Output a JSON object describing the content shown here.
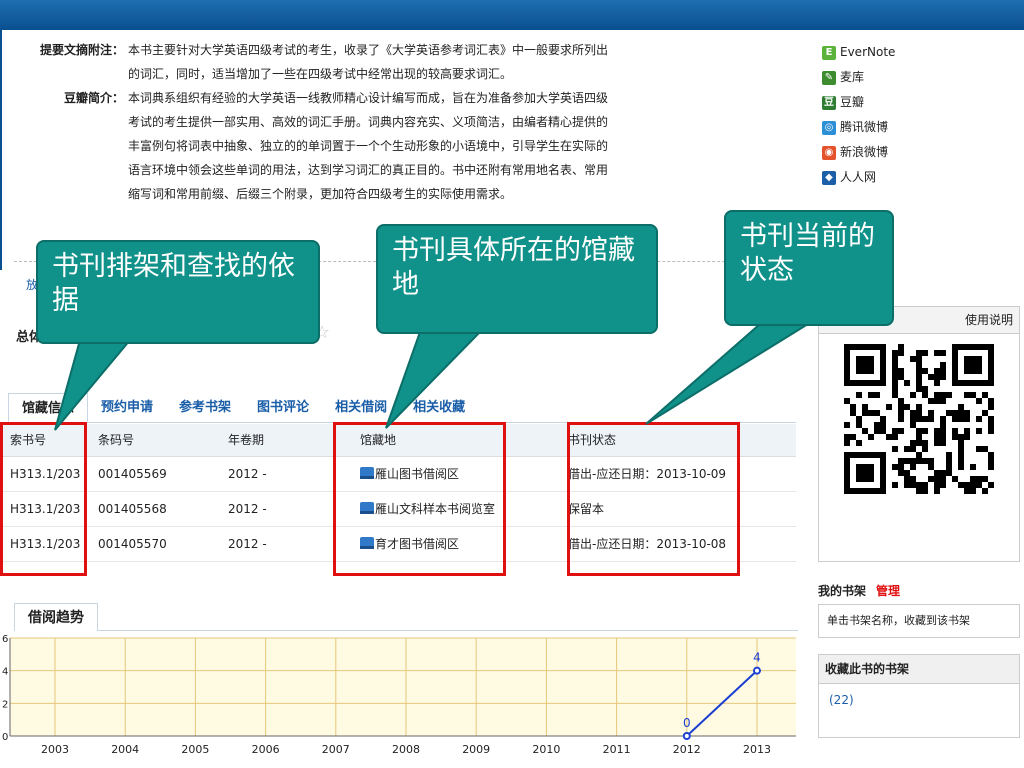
{
  "summary": {
    "abstract_label": "提要文摘附注：",
    "abstract_lines": [
      "本书主要针对大学英语四级考试的考生，收录了《大学英语参考词汇表》中一般要求所列出",
      "的词汇，同时，适当增加了一些在四级考试中经常出现的较高要求词汇。"
    ],
    "douban_label": "豆瓣简介：",
    "douban_lines": [
      "本词典系组织有经验的大学英语一线教师精心设计编写而成，旨在为准备参加大学英语四级",
      "考试的考生提供一部实用、高效的词汇手册。词典内容充实、义项简洁，由编者精心提供的",
      "丰富例句将词表中抽象、独立的的单词置于一个个生动形象的小语境中，引导学生在实际的",
      "语言环境中领会这些单词的用法，达到学习词汇的真正目的。书中还附有常用地名表、常用",
      "缩写词和常用前缀、后缀三个附录，更加符合四级考生的实际使用需求。"
    ]
  },
  "hidden_left": {
    "link": "放",
    "label": "总体"
  },
  "tabs": [
    "馆藏信息",
    "预约申请",
    "参考书架",
    "图书评论",
    "相关借阅",
    "相关收藏"
  ],
  "holdings": {
    "headers": [
      "索书号",
      "条码号",
      "年卷期",
      "馆藏地",
      "书刊状态"
    ],
    "rows": [
      [
        "H313.1/203",
        "001405569",
        "2012 -",
        "雁山图书借阅区",
        "借出-应还日期：2013-10-09"
      ],
      [
        "H313.1/203",
        "001405568",
        "2012 -",
        "雁山文科样本书阅览室",
        "保留本"
      ],
      [
        "H313.1/203",
        "001405570",
        "2012 -",
        "育才图书借阅区",
        "借出-应还日期：2013-10-08"
      ]
    ]
  },
  "trend": {
    "tab_label": "借阅趋势",
    "chart_data": {
      "type": "line",
      "x": [
        "2003",
        "2004",
        "2005",
        "2006",
        "2007",
        "2008",
        "2009",
        "2010",
        "2011",
        "2012",
        "2013"
      ],
      "y_ticks": [
        "6",
        "4",
        "2",
        "0"
      ],
      "ylim": [
        0,
        6
      ],
      "series": [
        {
          "points": [
            {
              "x": "2012",
              "y": 0
            },
            {
              "x": "2013",
              "y": 4
            }
          ],
          "labels": [
            "0",
            "4"
          ]
        }
      ],
      "grid": true,
      "colors": {
        "line": "#1a3fd1",
        "grid": "#e6c77a",
        "background": "#fffbe3"
      }
    }
  },
  "share": [
    {
      "label": "EverNote",
      "icon": "evernote-icon",
      "color": "#5bb33b",
      "glyph": "E"
    },
    {
      "label": "麦库",
      "icon": "maiku-icon",
      "color": "#3d8c2f",
      "glyph": "✎"
    },
    {
      "label": "豆瓣",
      "icon": "douban-icon",
      "color": "#2f7d32",
      "glyph": "豆"
    },
    {
      "label": "腾讯微博",
      "icon": "tencent-weibo-icon",
      "color": "#2d8fd5",
      "glyph": "◎"
    },
    {
      "label": "新浪微博",
      "icon": "sina-weibo-icon",
      "color": "#e5532d",
      "glyph": "◉"
    },
    {
      "label": "人人网",
      "icon": "renren-icon",
      "color": "#1d5ea8",
      "glyph": "◆"
    }
  ],
  "usage_label": "使用说明",
  "shelf": {
    "title": "我的书架",
    "manage": "管理",
    "note": "单击书架名称，收藏到该书架"
  },
  "collect": {
    "title": "收藏此书的书架",
    "count": "(22)"
  },
  "callouts": {
    "c1": "书刊排架和查找的依据",
    "c2": "书刊具体所在的馆藏地",
    "c3": "书刊当前的状态"
  }
}
